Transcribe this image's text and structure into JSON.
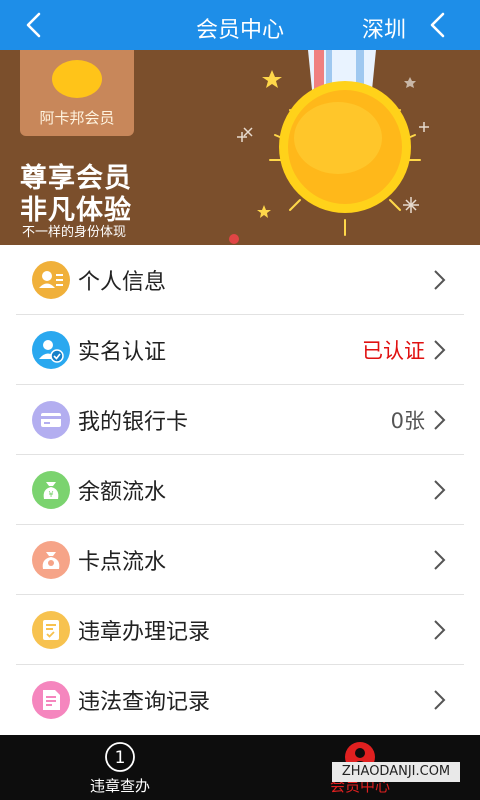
{
  "header": {
    "title": "会员中心",
    "city": "深圳",
    "bg_color": "#1e8ee8"
  },
  "banner": {
    "tag_text": "阿卡邦会员",
    "slogan_line1": "尊享会员",
    "slogan_line2": "非凡体验",
    "slogan_sub": "不一样的身份体现",
    "bg_color": "#7b4f2c"
  },
  "menu": {
    "items": [
      {
        "label": "个人信息",
        "value": "",
        "icon": "person-card-icon",
        "icon_color": "#f0b03a"
      },
      {
        "label": "实名认证",
        "value": "已认证",
        "value_color": "#e01010",
        "icon": "verified-user-icon",
        "icon_color": "#2aa8ef"
      },
      {
        "label": "我的银行卡",
        "value": "0张",
        "value_color": "#555555",
        "icon": "bank-card-icon",
        "icon_color": "#b3aef0"
      },
      {
        "label": "余额流水",
        "value": "",
        "icon": "money-bag-icon",
        "icon_color": "#7bd36f"
      },
      {
        "label": "卡点流水",
        "value": "",
        "icon": "coin-bag-icon",
        "icon_color": "#f6a488"
      },
      {
        "label": "违章办理记录",
        "value": "",
        "icon": "checklist-icon",
        "icon_color": "#f7c24f"
      },
      {
        "label": "违法查询记录",
        "value": "",
        "icon": "document-icon",
        "icon_color": "#f586be"
      }
    ]
  },
  "tabbar": {
    "tabs": [
      {
        "label": "违章查办",
        "icon": "number-one-icon",
        "active": false
      },
      {
        "label": "会员中心",
        "icon": "member-icon",
        "active": true
      }
    ],
    "active_color": "#e02020"
  },
  "watermark": "ZHAODANJI.COM"
}
